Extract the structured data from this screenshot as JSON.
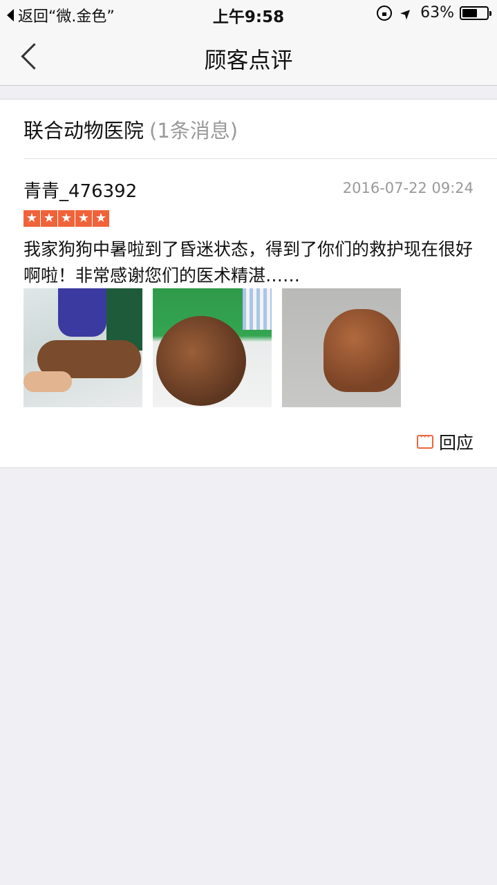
{
  "status_bar": {
    "back_app": "返回“微.金色”",
    "time": "上午9:58",
    "battery_percent": "63%",
    "battery_level": 0.63
  },
  "nav": {
    "title": "顾客点评"
  },
  "section": {
    "name": "联合动物医院",
    "count": "(1条消息)"
  },
  "review": {
    "user": "青青_476392",
    "date": "2016-07-22 09:24",
    "stars": 5,
    "text": "我家狗狗中暑啦到了昏迷状态，得到了你们的救护现在很好啊啦！非常感谢您们的医术精湛……",
    "reply_label": "回应"
  },
  "colors": {
    "accent": "#f0633a",
    "background": "#efeff4"
  }
}
